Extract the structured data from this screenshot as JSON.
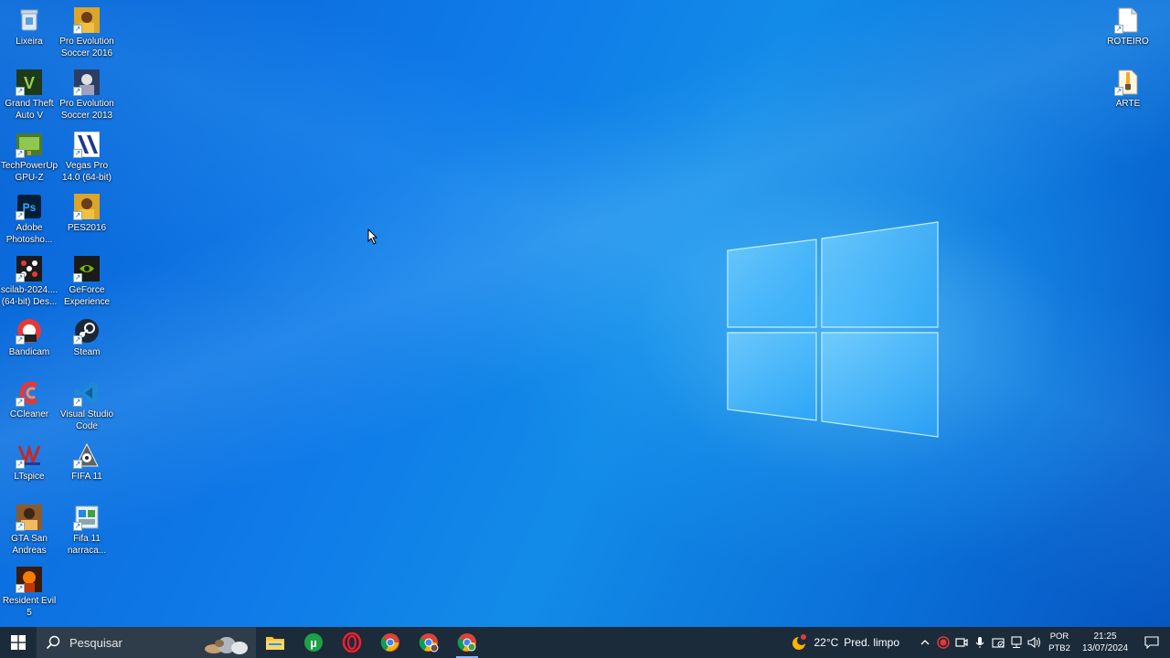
{
  "desktop": {
    "icons_left": [
      {
        "label": "Lixeira",
        "icon": "recycle-bin-icon"
      },
      {
        "label": "Pro Evolution Soccer 2016",
        "icon": "pes2016-icon"
      },
      {
        "label": "Grand Theft Auto V",
        "icon": "gta-v-icon"
      },
      {
        "label": "Pro Evolution Soccer 2013",
        "icon": "pes2013-icon"
      },
      {
        "label": "TechPowerUp GPU-Z",
        "icon": "gpu-z-icon"
      },
      {
        "label": "Vegas Pro 14.0 (64-bit)",
        "icon": "vegas-pro-icon"
      },
      {
        "label": "Adobe Photosho...",
        "icon": "photoshop-icon"
      },
      {
        "label": "PES2016",
        "icon": "pes2016-icon"
      },
      {
        "label": "scilab-2024.... (64-bit) Des...",
        "icon": "scilab-icon"
      },
      {
        "label": "GeForce Experience",
        "icon": "geforce-icon"
      },
      {
        "label": "Bandicam",
        "icon": "bandicam-icon"
      },
      {
        "label": "Steam",
        "icon": "steam-icon"
      },
      {
        "label": "CCleaner",
        "icon": "ccleaner-icon"
      },
      {
        "label": "Visual Studio Code",
        "icon": "vscode-icon"
      },
      {
        "label": "LTspice",
        "icon": "ltspice-icon"
      },
      {
        "label": "FIFA 11",
        "icon": "fifa11-icon"
      },
      {
        "label": "GTA San Andreas",
        "icon": "gta-sa-icon"
      },
      {
        "label": "Fifa 11 narraca...",
        "icon": "fifa11-narracao-icon"
      },
      {
        "label": "Resident Evil 5",
        "icon": "resident-evil-icon"
      }
    ],
    "icons_right": [
      {
        "label": "ROTEIRO",
        "icon": "document-icon"
      },
      {
        "label": "ARTE",
        "icon": "archive-icon"
      }
    ]
  },
  "taskbar": {
    "search_placeholder": "Pesquisar",
    "apps": [
      "file-explorer-icon",
      "utorrent-icon",
      "opera-icon",
      "chrome-icon",
      "chrome-profile-icon",
      "chrome-app-icon"
    ],
    "weather": {
      "temp": "22°C",
      "desc": "Pred. limpo"
    },
    "lang_top": "POR",
    "lang_bottom": "PTB2",
    "time": "21:25",
    "date": "13/07/2024"
  },
  "colors": {
    "taskbar": "#1b2b3a",
    "desktop_accent": "#0f7ae8"
  }
}
